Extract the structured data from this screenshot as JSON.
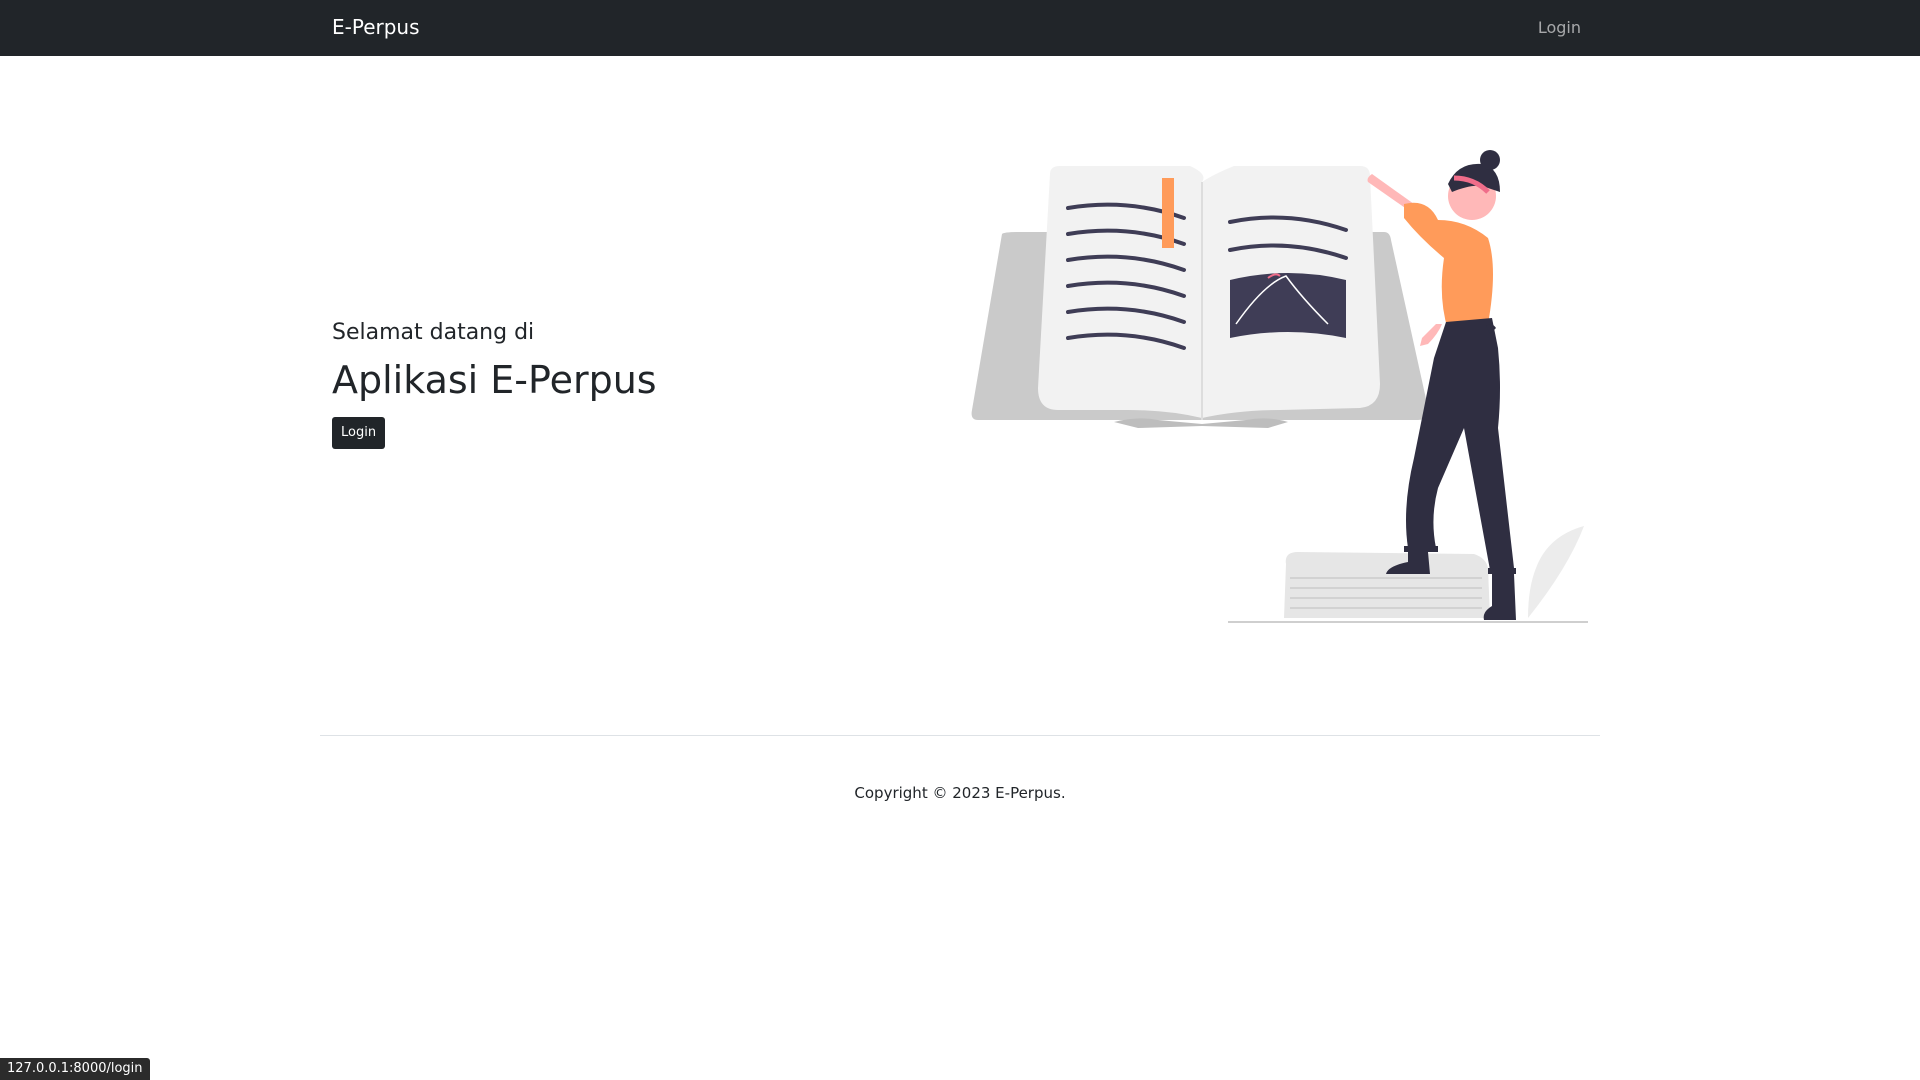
{
  "navbar": {
    "brand": "E-Perpus",
    "login_link": "Login"
  },
  "hero": {
    "subtitle": "Selamat datang di",
    "title": "Aplikasi E-Perpus",
    "login_button": "Login",
    "illustration": "woman-reading-giant-book-illustration"
  },
  "footer": {
    "copyright": "Copyright © 2023 E-Perpus."
  },
  "status_bar": {
    "url": "127.0.0.1:8000/login"
  },
  "colors": {
    "navbar_bg": "#212529",
    "accent_orange": "#ff9b5a",
    "dark_figure": "#2f2e41",
    "pink": "#f06d8a"
  }
}
